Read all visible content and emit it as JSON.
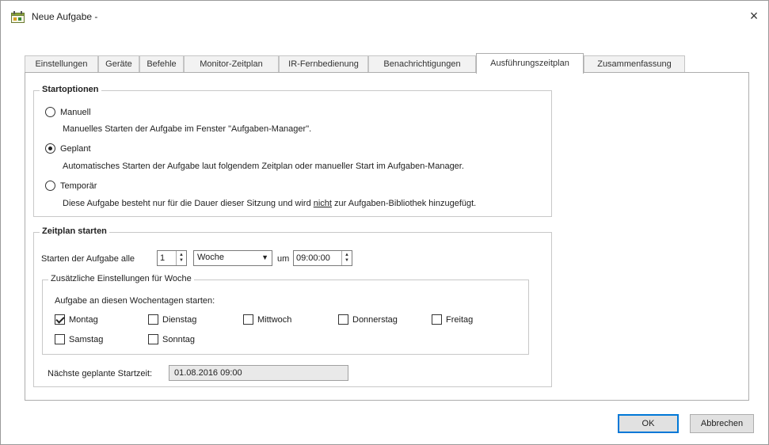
{
  "window": {
    "title": "Neue Aufgabe -",
    "close_label": "×"
  },
  "tabs": [
    {
      "label": "Einstellungen"
    },
    {
      "label": "Geräte"
    },
    {
      "label": "Befehle"
    },
    {
      "label": "Monitor-Zeitplan"
    },
    {
      "label": "IR-Fernbedienung"
    },
    {
      "label": "Benachrichtigungen"
    },
    {
      "label": "Ausführungszeitplan",
      "active": true
    },
    {
      "label": "Zusammenfassung"
    }
  ],
  "start_options": {
    "legend": "Startoptionen",
    "manual": {
      "label": "Manuell",
      "description": "Manuelles Starten der Aufgabe im Fenster \"Aufgaben-Manager\".",
      "selected": false
    },
    "scheduled": {
      "label": "Geplant",
      "description": "Automatisches Starten der Aufgabe laut folgendem Zeitplan oder manueller Start im Aufgaben-Manager.",
      "selected": true
    },
    "temporary": {
      "label": "Temporär",
      "description_before": "Diese Aufgabe besteht nur für die Dauer dieser Sitzung und wird ",
      "description_underlined": "nicht",
      "description_after": " zur Aufgaben-Bibliothek hinzugefügt.",
      "selected": false
    }
  },
  "schedule": {
    "legend": "Zeitplan starten",
    "start_every_label": "Starten der Aufgabe alle",
    "interval_value": "1",
    "interval_unit": "Woche",
    "at_label": "um",
    "time_value": "09:00:00",
    "weekly": {
      "legend": "Zusätzliche Einstellungen für Woche",
      "weekdays_label": "Aufgabe an diesen Wochentagen starten:",
      "days": [
        {
          "label": "Montag",
          "checked": true
        },
        {
          "label": "Dienstag",
          "checked": false
        },
        {
          "label": "Mittwoch",
          "checked": false
        },
        {
          "label": "Donnerstag",
          "checked": false
        },
        {
          "label": "Freitag",
          "checked": false
        },
        {
          "label": "Samstag",
          "checked": false
        },
        {
          "label": "Sonntag",
          "checked": false
        }
      ]
    },
    "next_start_label": "Nächste geplante Startzeit:",
    "next_start_value": "01.08.2016 09:00"
  },
  "buttons": {
    "ok": "OK",
    "cancel": "Abbrechen"
  }
}
